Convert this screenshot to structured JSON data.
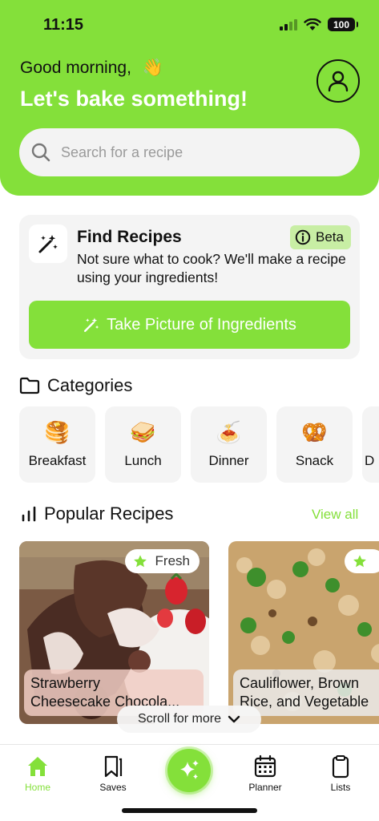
{
  "status": {
    "time": "11:15",
    "battery": "100"
  },
  "header": {
    "greeting": "Good morning,",
    "wave_emoji": "👋",
    "headline": "Let's bake something!",
    "profile_icon": "user-icon"
  },
  "search": {
    "placeholder": "Search for a recipe",
    "icon": "search-icon"
  },
  "find_recipes": {
    "title": "Find Recipes",
    "description": "Not sure what to cook? We'll make a recipe using your ingredients!",
    "badge": "Beta",
    "button_label": "Take Picture of Ingredients",
    "icon": "magic-wand-icon"
  },
  "categories": {
    "title": "Categories",
    "items": [
      {
        "label": "Breakfast",
        "emoji": "🥞"
      },
      {
        "label": "Lunch",
        "emoji": "🥪"
      },
      {
        "label": "Dinner",
        "emoji": "🍝"
      },
      {
        "label": "Snack",
        "emoji": "🥨"
      },
      {
        "label": "D",
        "emoji": ""
      }
    ]
  },
  "popular": {
    "title": "Popular Recipes",
    "view_all": "View all",
    "recipes": [
      {
        "badge": "Fresh",
        "title_line1": "Strawberry",
        "title_line2": "Cheesecake Chocola..."
      },
      {
        "badge": "",
        "title_line1": "Cauliflower, Brown",
        "title_line2": "Rice, and Vegetable"
      }
    ]
  },
  "scroll_hint": "Scroll for more",
  "tabbar": {
    "items": [
      {
        "label": "Home",
        "active": true
      },
      {
        "label": "Saves",
        "active": false
      },
      {
        "label": "",
        "active": false
      },
      {
        "label": "Planner",
        "active": false
      },
      {
        "label": "Lists",
        "active": false
      }
    ]
  },
  "colors": {
    "accent": "#84e03a",
    "badge_bg": "#c8eea4",
    "card_bg": "#f4f4f4"
  }
}
